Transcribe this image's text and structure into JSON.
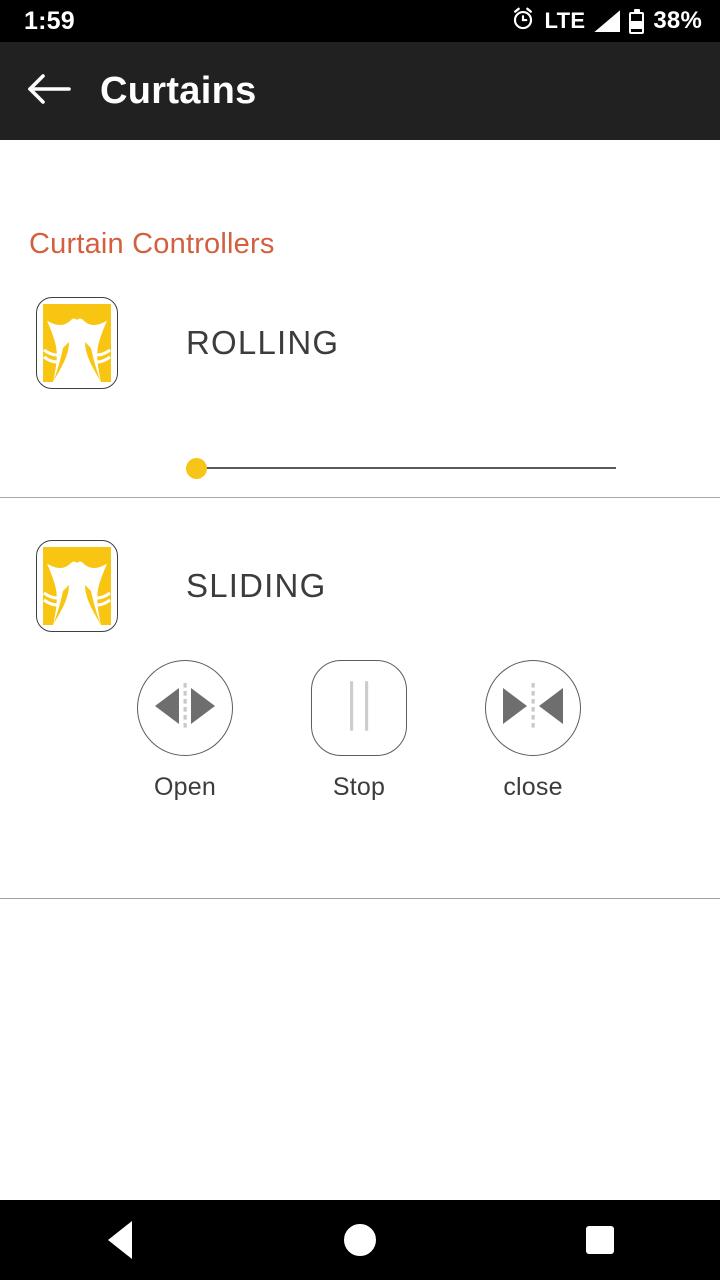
{
  "status_bar": {
    "time": "1:59",
    "alarm_icon": "alarm-clock-icon",
    "network_label": "LTE",
    "signal_icon": "signal-bars-icon",
    "battery_icon": "battery-icon",
    "battery_percent": "38%"
  },
  "app_bar": {
    "back_icon": "back-arrow-icon",
    "title": "Curtains"
  },
  "main": {
    "section_heading": "Curtain Controllers",
    "heading_color": "#d2603f",
    "accent_color": "#f7c518",
    "devices": [
      {
        "icon": "curtain-icon",
        "label": "ROLLING",
        "control_type": "slider",
        "slider": {
          "value": 0,
          "min": 0,
          "max": 100
        }
      },
      {
        "icon": "curtain-icon",
        "label": "SLIDING",
        "control_type": "buttons",
        "buttons": [
          {
            "label": "Open",
            "icon": "arrows-outward-icon",
            "shape": "circle"
          },
          {
            "label": "Stop",
            "icon": "pause-bars-icon",
            "shape": "squircle"
          },
          {
            "label": "close",
            "icon": "arrows-inward-icon",
            "shape": "circle"
          }
        ]
      }
    ]
  },
  "nav_bar": {
    "back_icon": "nav-back-triangle-icon",
    "home_icon": "nav-home-circle-icon",
    "recents_icon": "nav-recents-square-icon"
  }
}
